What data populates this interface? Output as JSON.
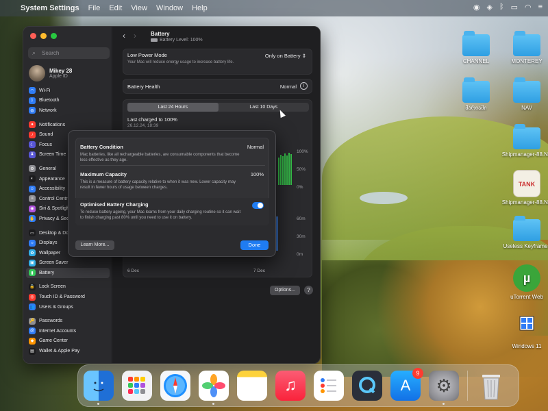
{
  "menubar": {
    "app_name": "System Settings",
    "menus": [
      "File",
      "Edit",
      "View",
      "Window",
      "Help"
    ]
  },
  "desktop": {
    "icons": [
      {
        "label": "CHANNEL",
        "type": "folder"
      },
      {
        "label": "MONTEREY",
        "type": "folder"
      },
      {
        "label": "მარიამი",
        "type": "folder"
      },
      {
        "label": "NAV",
        "type": "folder"
      },
      {
        "label": "Shipmanager-88.NK",
        "type": "folder"
      },
      {
        "label": "Shipmanager-88.NK",
        "type": "app"
      },
      {
        "label": "Useless Keyframes",
        "type": "folder"
      },
      {
        "label": "uTorrent Web",
        "type": "app"
      },
      {
        "label": "Windows 11",
        "type": "app"
      }
    ],
    "tank_label": "TANK"
  },
  "window": {
    "search_placeholder": "Search",
    "profile": {
      "name": "Mikey 28",
      "sub": "Apple ID"
    },
    "sidebar": [
      {
        "label": "Wi-Fi",
        "icon": "wifi-icon",
        "color": "#2f7cf6"
      },
      {
        "label": "Bluetooth",
        "icon": "bluetooth-icon",
        "color": "#2f7cf6"
      },
      {
        "label": "Network",
        "icon": "network-icon",
        "color": "#2f7cf6"
      },
      {
        "gap": true
      },
      {
        "label": "Notifications",
        "icon": "notifications-icon",
        "color": "#ff3b30"
      },
      {
        "label": "Sound",
        "icon": "sound-icon",
        "color": "#ff3b30"
      },
      {
        "label": "Focus",
        "icon": "focus-icon",
        "color": "#5856d6"
      },
      {
        "label": "Screen Time",
        "icon": "screen-time-icon",
        "color": "#5856d6"
      },
      {
        "gap": true
      },
      {
        "label": "General",
        "icon": "general-icon",
        "color": "#8e8e93"
      },
      {
        "label": "Appearance",
        "icon": "appearance-icon",
        "color": "#1c1c1e"
      },
      {
        "label": "Accessibility",
        "icon": "accessibility-icon",
        "color": "#2f7cf6"
      },
      {
        "label": "Control Centre",
        "icon": "control-centre-icon",
        "color": "#8e8e93"
      },
      {
        "label": "Siri & Spotlight",
        "icon": "siri-icon",
        "color": "#af52de"
      },
      {
        "label": "Privacy & Security",
        "icon": "privacy-icon",
        "color": "#2f7cf6"
      },
      {
        "gap": true
      },
      {
        "label": "Desktop & Dock",
        "icon": "desktop-dock-icon",
        "color": "#1c1c1e"
      },
      {
        "label": "Displays",
        "icon": "displays-icon",
        "color": "#2f7cf6"
      },
      {
        "label": "Wallpaper",
        "icon": "wallpaper-icon",
        "color": "#32ade6"
      },
      {
        "label": "Screen Saver",
        "icon": "screen-saver-icon",
        "color": "#32ade6"
      },
      {
        "label": "Battery",
        "icon": "battery-icon",
        "color": "#34c759",
        "active": true
      },
      {
        "gap": true
      },
      {
        "label": "Lock Screen",
        "icon": "lock-screen-icon",
        "color": "#1c1c1e"
      },
      {
        "label": "Touch ID & Password",
        "icon": "touch-id-icon",
        "color": "#ff3b30"
      },
      {
        "label": "Users & Groups",
        "icon": "users-icon",
        "color": "#2f7cf6"
      },
      {
        "gap": true
      },
      {
        "label": "Passwords",
        "icon": "passwords-icon",
        "color": "#8e8e93"
      },
      {
        "label": "Internet Accounts",
        "icon": "internet-accounts-icon",
        "color": "#2f7cf6"
      },
      {
        "label": "Game Center",
        "icon": "game-center-icon",
        "color": "#ff9500"
      },
      {
        "label": "Wallet & Apple Pay",
        "icon": "wallet-icon",
        "color": "#1c1c1e"
      }
    ],
    "main": {
      "title": "Battery",
      "subtitle": "Battery Level: 100%",
      "low_power": {
        "label": "Low Power Mode",
        "desc": "Your Mac will reduce energy usage to increase battery life.",
        "value": "Only on Battery"
      },
      "health": {
        "label": "Battery Health",
        "value": "Normal"
      },
      "tabs": [
        "Last 24 Hours",
        "Last 10 Days"
      ],
      "active_tab": 0,
      "last_charged": "Last charged to 100%",
      "last_charged_date": "26.12.24, 18:39",
      "level_axis": [
        "100%",
        "50%",
        "0%"
      ],
      "usage_axis": [
        "60m",
        "30m",
        "0m"
      ],
      "x_labels": [
        "6 Dec",
        "7 Dec"
      ],
      "options_label": "Options...",
      "help_label": "?"
    },
    "modal": {
      "condition": {
        "title": "Battery Condition",
        "value": "Normal",
        "text": "Mac batteries, like all rechargeable batteries, are consumable components that become less effective as they age."
      },
      "capacity": {
        "title": "Maximum Capacity",
        "value": "100%",
        "text": "This is a measure of battery capacity relative to when it was new. Lower capacity may result in fewer hours of usage between charges."
      },
      "optimised": {
        "title": "Optimised Battery Charging",
        "text": "To reduce battery ageing, your Mac learns from your daily charging routine so it can wait to finish charging past 80% until you need to use it on battery.",
        "enabled": true
      },
      "learn_more": "Learn More...",
      "done": "Done"
    }
  },
  "dock": {
    "apps": [
      {
        "name": "finder-icon",
        "bg": "#3a8ee6"
      },
      {
        "name": "launchpad-icon",
        "bg": "#e8e8ea"
      },
      {
        "name": "safari-icon",
        "bg": "#f5f7fa"
      },
      {
        "name": "photos-icon",
        "bg": "#ffffff"
      },
      {
        "name": "notes-icon",
        "bg": "#fdd23b"
      },
      {
        "name": "music-icon",
        "bg": "#fb3c56"
      },
      {
        "name": "reminders-icon",
        "bg": "#ffffff"
      },
      {
        "name": "quicktime-icon",
        "bg": "#2a2f3a"
      },
      {
        "name": "app-store-icon",
        "bg": "#1c8cf5",
        "badge": "9"
      },
      {
        "name": "system-settings-icon",
        "bg": "#8e8e93"
      }
    ],
    "trash": "trash-icon"
  }
}
